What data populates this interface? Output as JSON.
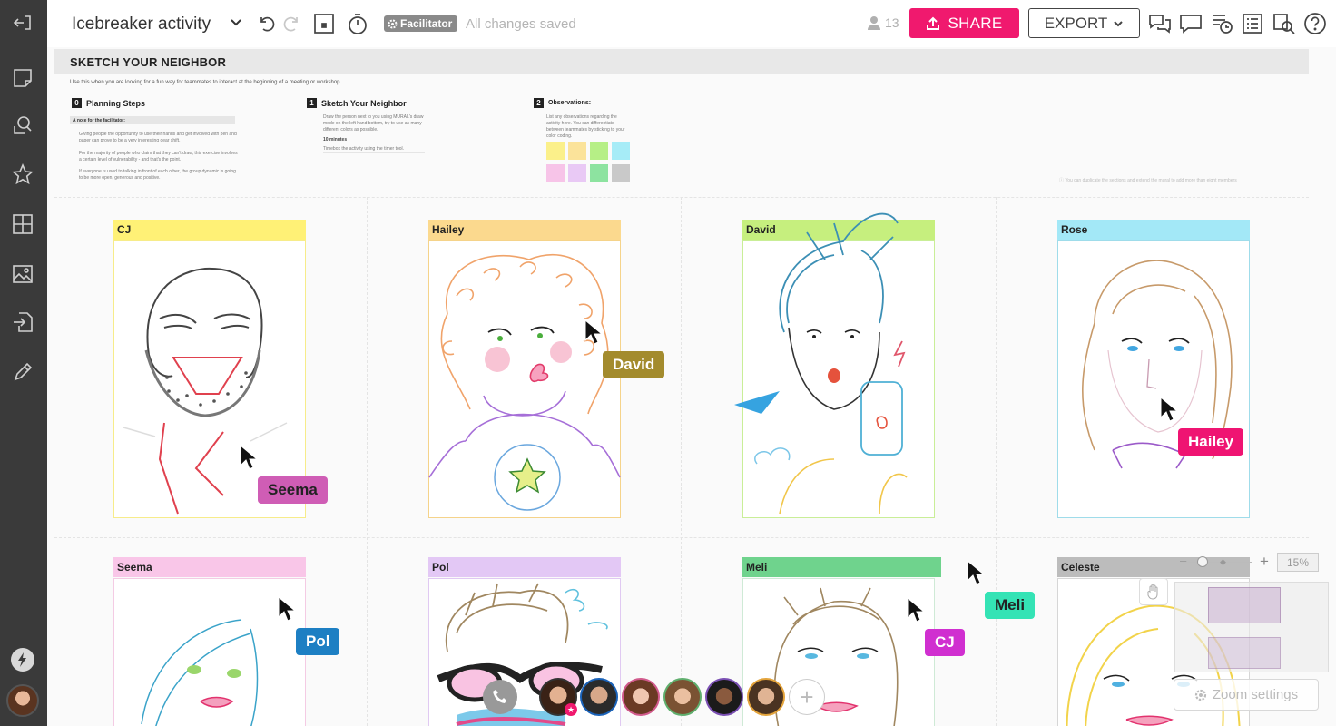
{
  "app": {
    "board_title": "Icebreaker activity",
    "facilitator_badge": "Facilitator",
    "save_status": "All changes saved",
    "online_count": "13",
    "share_label": "SHARE",
    "export_label": "EXPORT",
    "brand_color": "#f0196e"
  },
  "sidebar": {
    "items": [
      "exit-icon",
      "sticky-note-icon",
      "search-shapes-icon",
      "star-icon",
      "grid-icon",
      "image-icon",
      "import-icon",
      "pencil-icon"
    ],
    "bolt_icon": "bolt-icon",
    "user_avatar": "avatar"
  },
  "board": {
    "header": "SKETCH YOUR NEIGHBOR",
    "intro": "Use this when you are looking for a fun way for teammates to interact at the beginning of a meeting or workshop.",
    "steps": [
      {
        "num": "0",
        "title": "Planning Steps"
      },
      {
        "num": "1",
        "title": "Sketch Your Neighbor"
      },
      {
        "num": "2",
        "title": "Observations:"
      }
    ],
    "facilitator_note": "A note for the facilitator:",
    "planning_bullets": [
      "Giving people the opportunity to use their hands and get involved with pen and paper can prove to be a very interesting gear shift.",
      "For the majority of people who claim that they can't draw, this exercise involves a certain level of vulnerability - and that's the point.",
      "If everyone is used to talking in front of each other, the group dynamic is going to be more open, generous and positive."
    ],
    "sketch_text": "Draw the person next to you using MURAL's draw mode on the left hand bottom, try to use as many different colors as possible.",
    "sketch_time": "10 minutes",
    "sketch_hint": "Timebox the activity using the timer tool.",
    "observe_text": "List any observations regarding the activity here. You can differentiate between teammates by sticking to your color coding.",
    "info_note": "You can duplicate the sections and extend the mural to add more than eight members",
    "swatches": [
      "#fbf08a",
      "#fbe39a",
      "#b6ef86",
      "#a6ecf7",
      "#f7c4e8",
      "#e9c9f5",
      "#8de3a0",
      "#c9c9c9"
    ]
  },
  "cards": [
    {
      "name": "CJ",
      "tag_color": "#fff176",
      "border": "#f7ec8a"
    },
    {
      "name": "Hailey",
      "tag_color": "#fbd98e",
      "border": "#f5d38a"
    },
    {
      "name": "David",
      "tag_color": "#c6ef7e",
      "border": "#c9ee97"
    },
    {
      "name": "Rose",
      "tag_color": "#a3e8f7",
      "border": "#9fdcea"
    },
    {
      "name": "Seema",
      "tag_color": "#f9c6e8",
      "border": "#f4cbe4"
    },
    {
      "name": "Pol",
      "tag_color": "#e3c8f5",
      "border": "#e0c9f2"
    },
    {
      "name": "Meli",
      "tag_color": "#6fd38d",
      "border": "#cfead6"
    },
    {
      "name": "Celeste",
      "tag_color": "#bcbcbc",
      "border": "#d6d6d6"
    }
  ],
  "cursors": [
    {
      "label": "David",
      "color": "#a38b2d",
      "text_color": "#ffffff"
    },
    {
      "label": "Hailey",
      "color": "#ef1472",
      "text_color": "#ffffff"
    },
    {
      "label": "Seema",
      "color": "#cf5db5",
      "text_color": "#222222"
    },
    {
      "label": "Pol",
      "color": "#1d7fc3",
      "text_color": "#ffffff"
    },
    {
      "label": "CJ",
      "color": "#d02fd0",
      "text_color": "#ffffff"
    },
    {
      "label": "Meli",
      "color": "#34e3b5",
      "text_color": "#222222"
    }
  ],
  "zoom": {
    "level": "15%",
    "settings_label": "Zoom settings"
  },
  "video_call": {
    "participants": [
      "participant-1",
      "participant-2",
      "participant-3",
      "participant-4",
      "participant-5",
      "participant-6"
    ]
  }
}
